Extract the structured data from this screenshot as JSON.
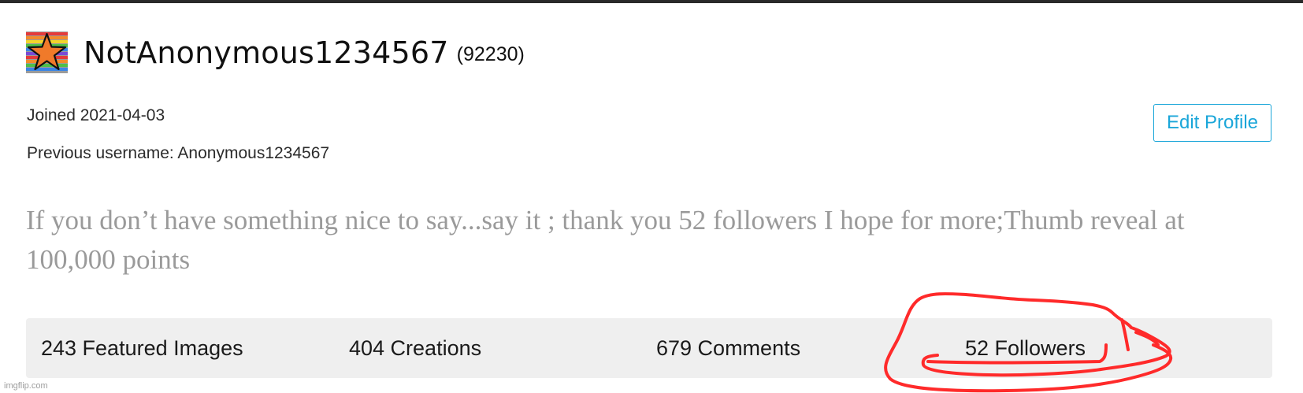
{
  "profile": {
    "username": "NotAnonymous1234567",
    "points": "(92230)",
    "joined": "Joined 2021-04-03",
    "previous_username": "Previous username: Anonymous1234567",
    "edit_button": "Edit Profile",
    "bio": "If you don’t have something nice to say...say it ; thank you 52 followers I hope for more;Thumb reveal at 100,000 points"
  },
  "stats": {
    "featured": "243 Featured Images",
    "creations": "404 Creations",
    "comments": "679 Comments",
    "followers": "52 Followers"
  },
  "watermark": "imgflip.com",
  "colors": {
    "accent": "#1aa6d9",
    "bio_text": "#9a9a9a",
    "stats_bg": "#efefef",
    "annotation": "#ff2a2a"
  },
  "icons": {
    "avatar": "rainbow-star-icon",
    "annotation": "red-circle-annotation"
  }
}
